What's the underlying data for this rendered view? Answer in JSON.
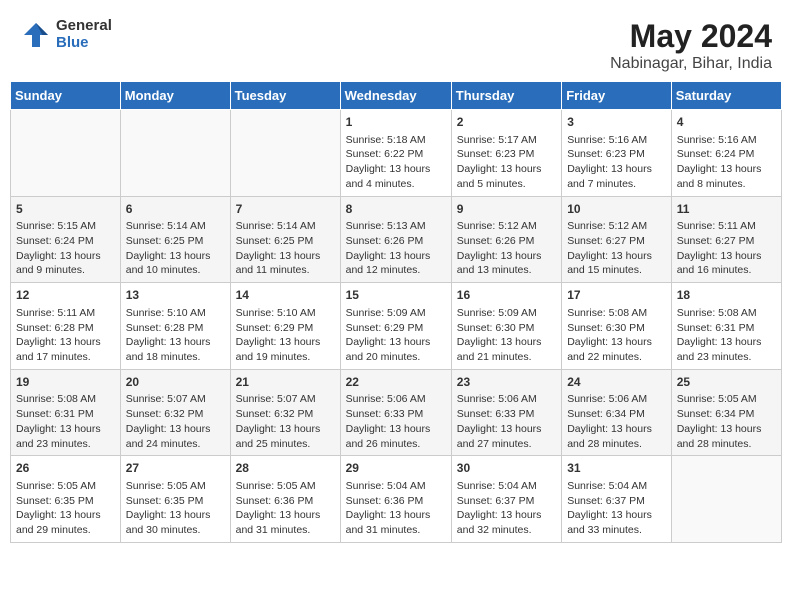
{
  "logo": {
    "general": "General",
    "blue": "Blue"
  },
  "title": "May 2024",
  "location": "Nabinagar, Bihar, India",
  "days_of_week": [
    "Sunday",
    "Monday",
    "Tuesday",
    "Wednesday",
    "Thursday",
    "Friday",
    "Saturday"
  ],
  "weeks": [
    [
      {
        "day": "",
        "info": ""
      },
      {
        "day": "",
        "info": ""
      },
      {
        "day": "",
        "info": ""
      },
      {
        "day": "1",
        "info": "Sunrise: 5:18 AM\nSunset: 6:22 PM\nDaylight: 13 hours\nand 4 minutes."
      },
      {
        "day": "2",
        "info": "Sunrise: 5:17 AM\nSunset: 6:23 PM\nDaylight: 13 hours\nand 5 minutes."
      },
      {
        "day": "3",
        "info": "Sunrise: 5:16 AM\nSunset: 6:23 PM\nDaylight: 13 hours\nand 7 minutes."
      },
      {
        "day": "4",
        "info": "Sunrise: 5:16 AM\nSunset: 6:24 PM\nDaylight: 13 hours\nand 8 minutes."
      }
    ],
    [
      {
        "day": "5",
        "info": "Sunrise: 5:15 AM\nSunset: 6:24 PM\nDaylight: 13 hours\nand 9 minutes."
      },
      {
        "day": "6",
        "info": "Sunrise: 5:14 AM\nSunset: 6:25 PM\nDaylight: 13 hours\nand 10 minutes."
      },
      {
        "day": "7",
        "info": "Sunrise: 5:14 AM\nSunset: 6:25 PM\nDaylight: 13 hours\nand 11 minutes."
      },
      {
        "day": "8",
        "info": "Sunrise: 5:13 AM\nSunset: 6:26 PM\nDaylight: 13 hours\nand 12 minutes."
      },
      {
        "day": "9",
        "info": "Sunrise: 5:12 AM\nSunset: 6:26 PM\nDaylight: 13 hours\nand 13 minutes."
      },
      {
        "day": "10",
        "info": "Sunrise: 5:12 AM\nSunset: 6:27 PM\nDaylight: 13 hours\nand 15 minutes."
      },
      {
        "day": "11",
        "info": "Sunrise: 5:11 AM\nSunset: 6:27 PM\nDaylight: 13 hours\nand 16 minutes."
      }
    ],
    [
      {
        "day": "12",
        "info": "Sunrise: 5:11 AM\nSunset: 6:28 PM\nDaylight: 13 hours\nand 17 minutes."
      },
      {
        "day": "13",
        "info": "Sunrise: 5:10 AM\nSunset: 6:28 PM\nDaylight: 13 hours\nand 18 minutes."
      },
      {
        "day": "14",
        "info": "Sunrise: 5:10 AM\nSunset: 6:29 PM\nDaylight: 13 hours\nand 19 minutes."
      },
      {
        "day": "15",
        "info": "Sunrise: 5:09 AM\nSunset: 6:29 PM\nDaylight: 13 hours\nand 20 minutes."
      },
      {
        "day": "16",
        "info": "Sunrise: 5:09 AM\nSunset: 6:30 PM\nDaylight: 13 hours\nand 21 minutes."
      },
      {
        "day": "17",
        "info": "Sunrise: 5:08 AM\nSunset: 6:30 PM\nDaylight: 13 hours\nand 22 minutes."
      },
      {
        "day": "18",
        "info": "Sunrise: 5:08 AM\nSunset: 6:31 PM\nDaylight: 13 hours\nand 23 minutes."
      }
    ],
    [
      {
        "day": "19",
        "info": "Sunrise: 5:08 AM\nSunset: 6:31 PM\nDaylight: 13 hours\nand 23 minutes."
      },
      {
        "day": "20",
        "info": "Sunrise: 5:07 AM\nSunset: 6:32 PM\nDaylight: 13 hours\nand 24 minutes."
      },
      {
        "day": "21",
        "info": "Sunrise: 5:07 AM\nSunset: 6:32 PM\nDaylight: 13 hours\nand 25 minutes."
      },
      {
        "day": "22",
        "info": "Sunrise: 5:06 AM\nSunset: 6:33 PM\nDaylight: 13 hours\nand 26 minutes."
      },
      {
        "day": "23",
        "info": "Sunrise: 5:06 AM\nSunset: 6:33 PM\nDaylight: 13 hours\nand 27 minutes."
      },
      {
        "day": "24",
        "info": "Sunrise: 5:06 AM\nSunset: 6:34 PM\nDaylight: 13 hours\nand 28 minutes."
      },
      {
        "day": "25",
        "info": "Sunrise: 5:05 AM\nSunset: 6:34 PM\nDaylight: 13 hours\nand 28 minutes."
      }
    ],
    [
      {
        "day": "26",
        "info": "Sunrise: 5:05 AM\nSunset: 6:35 PM\nDaylight: 13 hours\nand 29 minutes."
      },
      {
        "day": "27",
        "info": "Sunrise: 5:05 AM\nSunset: 6:35 PM\nDaylight: 13 hours\nand 30 minutes."
      },
      {
        "day": "28",
        "info": "Sunrise: 5:05 AM\nSunset: 6:36 PM\nDaylight: 13 hours\nand 31 minutes."
      },
      {
        "day": "29",
        "info": "Sunrise: 5:04 AM\nSunset: 6:36 PM\nDaylight: 13 hours\nand 31 minutes."
      },
      {
        "day": "30",
        "info": "Sunrise: 5:04 AM\nSunset: 6:37 PM\nDaylight: 13 hours\nand 32 minutes."
      },
      {
        "day": "31",
        "info": "Sunrise: 5:04 AM\nSunset: 6:37 PM\nDaylight: 13 hours\nand 33 minutes."
      },
      {
        "day": "",
        "info": ""
      }
    ]
  ]
}
